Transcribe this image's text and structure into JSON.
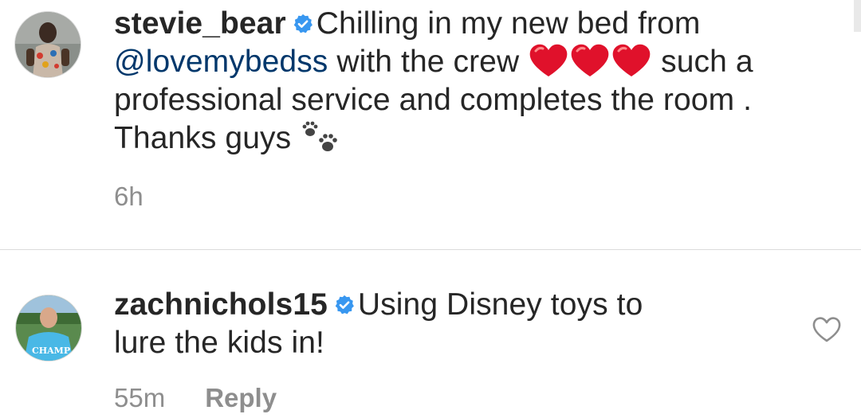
{
  "comments": [
    {
      "username": "stevie_bear",
      "verified": true,
      "text_part1": "Chilling in my new bed from",
      "mention": "@lovemybedss",
      "text_part2": "with the crew",
      "emojis": [
        "red-heart",
        "red-heart",
        "red-heart"
      ],
      "text_part3": "such a",
      "text_line3": "professional service and completes the room .",
      "text_line4": "Thanks guys",
      "trailing_emoji": "paw-prints",
      "time": "6h"
    },
    {
      "username": "zachnichols15",
      "verified": true,
      "text_line1": "Using Disney toys to",
      "text_line2": "lure the kids in!",
      "time": "55m",
      "reply_label": "Reply",
      "like_icon": "heart-outline-icon",
      "shirt_text": "CHAMP"
    }
  ],
  "colors": {
    "text": "#262626",
    "muted": "#8e8e8e",
    "mention": "#00376b",
    "verified": "#3897f0",
    "heart": "#e0112b",
    "divider": "#dbdbdb"
  }
}
